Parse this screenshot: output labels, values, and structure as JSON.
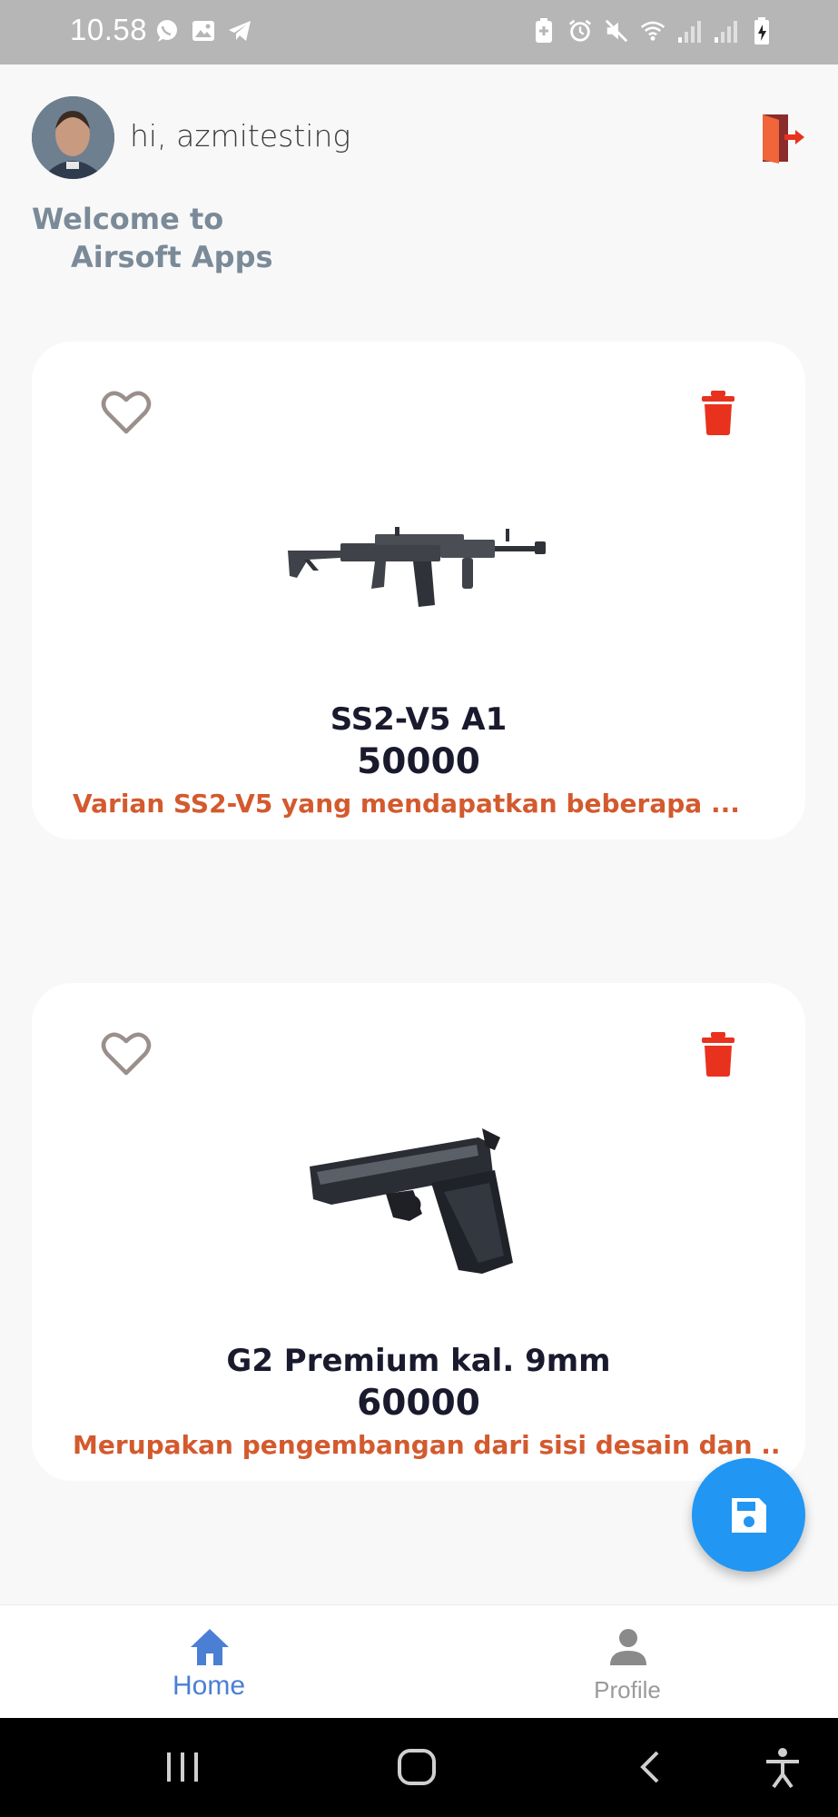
{
  "status_bar": {
    "time": "10.58",
    "left_icons": [
      "whatsapp-icon",
      "gallery-icon",
      "telegram-icon"
    ],
    "right_icons": [
      "battery-saver-icon",
      "alarm-icon",
      "mute-icon",
      "wifi-icon",
      "signal-icon",
      "signal-icon",
      "battery-charging-icon"
    ]
  },
  "header": {
    "greeting": "hi, azmitesting",
    "welcome_line1": "Welcome to",
    "welcome_line2": "Airsoft Apps",
    "logout_icon": "logout-door-icon"
  },
  "products": [
    {
      "name": "SS2-V5 A1",
      "price": "50000",
      "description": "Varian SS2-V5 yang mendapatkan beberapa ...",
      "image": "assault-rifle-image"
    },
    {
      "name": "G2 Premium kal. 9mm",
      "price": "60000",
      "description": "Merupakan pengembangan dari sisi desain dan ...",
      "image": "pistol-image"
    }
  ],
  "fab": {
    "icon": "save-icon"
  },
  "bottom_nav": {
    "items": [
      {
        "label": "Home",
        "icon": "home-icon",
        "active": true
      },
      {
        "label": "Profile",
        "icon": "person-icon",
        "active": false
      }
    ]
  },
  "colors": {
    "accent": "#2196f3",
    "nav_active": "#4a7fd4",
    "description": "#d35a2e",
    "delete": "#e8321e",
    "welcome": "#7a8a98"
  }
}
